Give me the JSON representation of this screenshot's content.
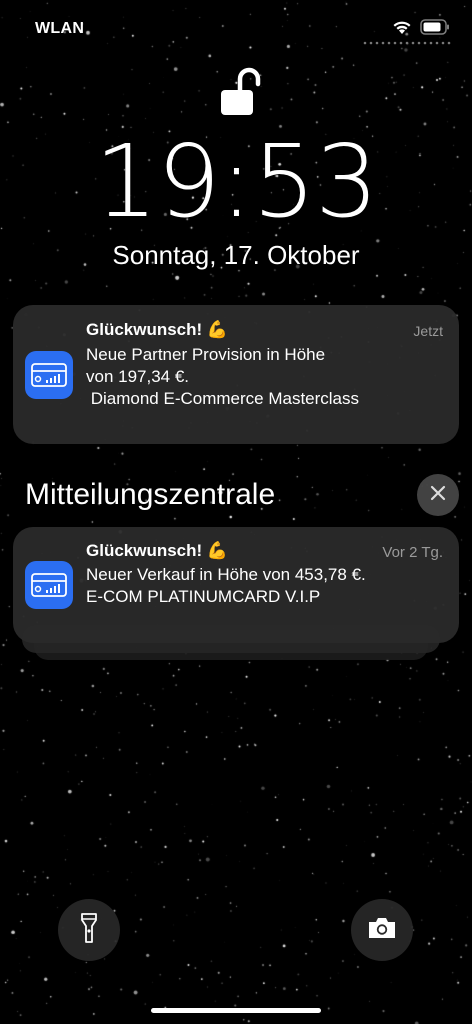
{
  "status_bar": {
    "carrier": "WLAN",
    "icons": [
      "wifi-icon",
      "battery-icon"
    ]
  },
  "lock_screen": {
    "lock_icon": "unlocked-padlock-icon",
    "time": "19:53",
    "date": "Sonntag, 17. Oktober"
  },
  "notifications": [
    {
      "app_icon": "card-icon",
      "title": "Glückwunsch! 💪",
      "time": "Jetzt",
      "body": "Neue Partner Provision in Höhe\nvon 197,34 €.\n Diamond E-Commerce Masterclass"
    }
  ],
  "notification_center": {
    "title": "Mitteilungszentrale",
    "close_icon": "close-icon",
    "items": [
      {
        "app_icon": "card-icon",
        "title": "Glückwunsch! 💪",
        "time": "Vor 2 Tg.",
        "body": "Neuer Verkauf in Höhe von 453,78 €.\nE-COM PLATINUMCARD V.I.P"
      }
    ]
  },
  "quick_actions": {
    "left_icon": "flashlight-icon",
    "right_icon": "camera-icon"
  },
  "colors": {
    "background": "#000000",
    "card": "#2a2a2a",
    "app_icon": "#2b6ef2",
    "secondary_text": "#9a9a9a"
  }
}
